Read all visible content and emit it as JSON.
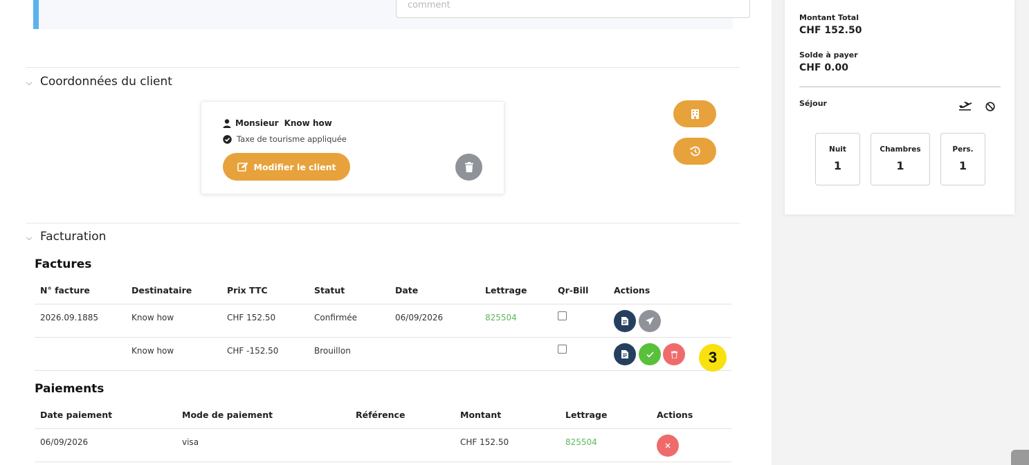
{
  "comment": {
    "placeholder": "comment",
    "value": ""
  },
  "client_section": {
    "title": "Coordonnées du client",
    "salutation": "Monsieur",
    "name": "Know how",
    "tax_text": "Taxe de tourisme appliquée",
    "modify_label": "Modifier le client"
  },
  "billing_section": {
    "title": "Facturation",
    "invoices_title": "Factures",
    "invoice_headers": [
      "N° facture",
      "Destinataire",
      "Prix TTC",
      "Statut",
      "Date",
      "Lettrage",
      "Qr-Bill",
      "Actions"
    ],
    "invoices": [
      {
        "number": "2026.09.1885",
        "recipient": "Know how",
        "price": "CHF 152.50",
        "status": "Confirmée",
        "date": "06/09/2026",
        "lettrage": "825504"
      },
      {
        "number": "",
        "recipient": "Know how",
        "price": "CHF -152.50",
        "status": "Brouillon",
        "date": "",
        "lettrage": ""
      }
    ],
    "step_badge": "3",
    "payments_title": "Paiements",
    "payment_headers": [
      "Date paiement",
      "Mode de paiement",
      "Référence",
      "Montant",
      "Lettrage",
      "Actions"
    ],
    "payments": [
      {
        "date": "06/09/2026",
        "mode": "visa",
        "reference": "",
        "amount": "CHF 152.50",
        "lettrage": "825504"
      }
    ]
  },
  "summary": {
    "total_label": "Montant Total",
    "total_value": "CHF 152.50",
    "balance_label": "Solde à payer",
    "balance_value": "CHF 0.00",
    "stay_label": "Séjour",
    "stats": [
      {
        "label": "Nuit",
        "value": "1"
      },
      {
        "label": "Chambres",
        "value": "1"
      },
      {
        "label": "Pers.",
        "value": "1"
      }
    ]
  },
  "colors": {
    "accent_orange": "#e8a23b",
    "navy": "#25405f",
    "success": "#59c03b",
    "danger": "#ef6b6b",
    "lettrage_green": "#5cb85c",
    "comment_border": "#5ab2ee",
    "badge_yellow": "#f8e10f"
  }
}
